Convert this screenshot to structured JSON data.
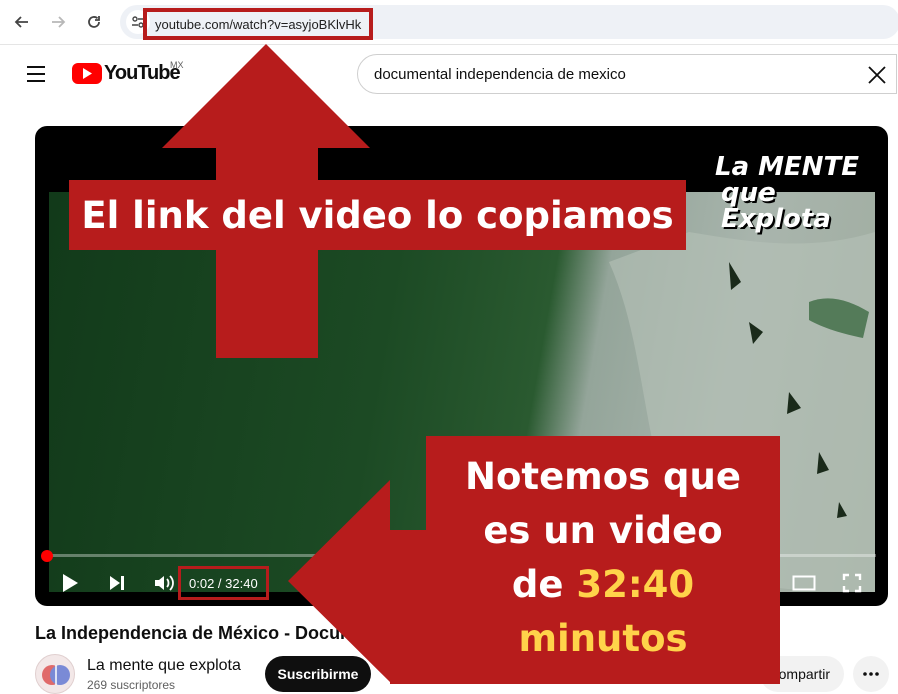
{
  "browser": {
    "url": "youtube.com/watch?v=asyjoBKlvHk"
  },
  "header": {
    "logo_text": "YouTube",
    "region": "MX",
    "search_value": "documental independencia de mexico"
  },
  "player": {
    "time": "0:02 / 32:40",
    "brand_line1": "La MENTE",
    "brand_line2": "que Explota"
  },
  "video": {
    "title": "La Independencia de México - Documental",
    "channel": "La mente que explota",
    "subscribers": "269 suscriptores",
    "subscribe_label": "Suscribirme",
    "share_label": "Compartir"
  },
  "annotations": {
    "label1": "El link del video lo copiamos",
    "label2_line1": "Notemos que",
    "label2_line2": "es un video",
    "label2_line3_prefix": "de ",
    "label2_line3_highlight": "32:40",
    "label2_line4": "minutos",
    "color_red": "#b71c1c",
    "color_yellow": "#ffd34a"
  }
}
